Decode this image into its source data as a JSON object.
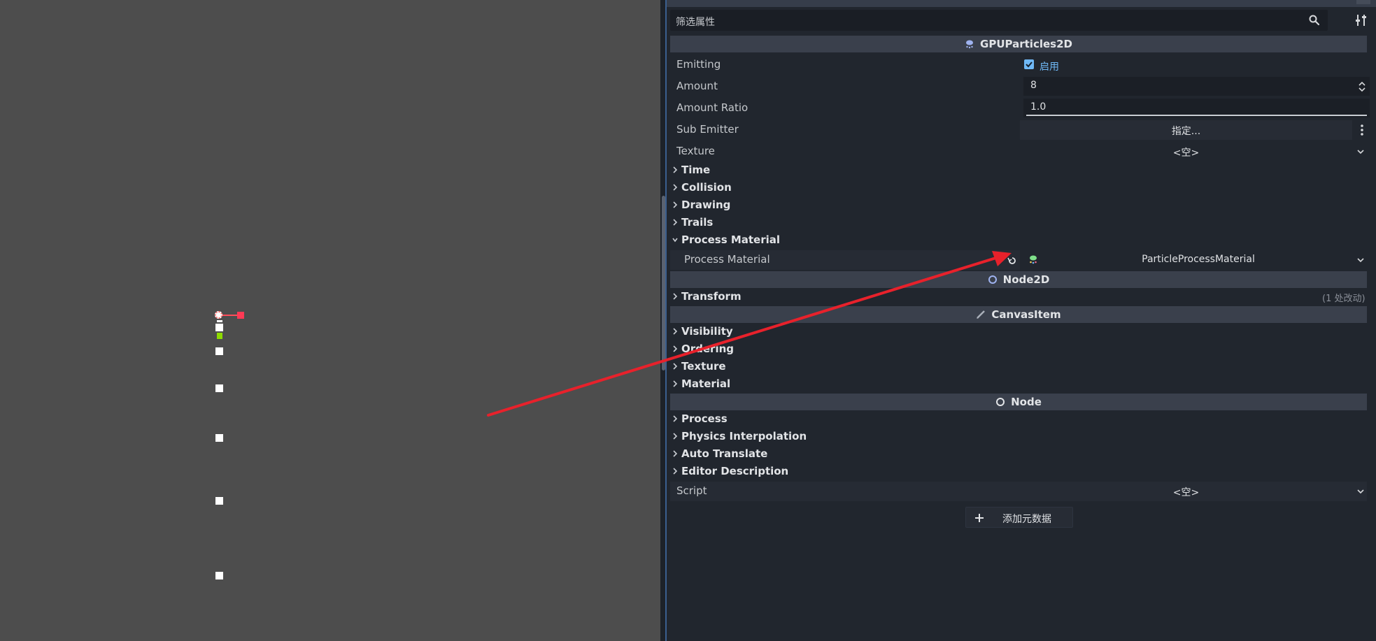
{
  "filter": {
    "placeholder": "筛选属性"
  },
  "sections": {
    "gpu": "GPUParticles2D",
    "node2d": "Node2D",
    "canvas": "CanvasItem",
    "node": "Node"
  },
  "props": {
    "emitting": {
      "label": "Emitting",
      "checked": true,
      "value": "启用"
    },
    "amount": {
      "label": "Amount",
      "value": "8"
    },
    "amount_ratio": {
      "label": "Amount Ratio",
      "value": "1.0"
    },
    "sub_emitter": {
      "label": "Sub Emitter",
      "value": "指定..."
    },
    "texture": {
      "label": "Texture",
      "value": "<空>"
    },
    "process_material": {
      "label": "Process Material",
      "value": "ParticleProcessMaterial"
    },
    "script": {
      "label": "Script",
      "value": "<空>"
    }
  },
  "groups": {
    "time": "Time",
    "collision": "Collision",
    "drawing": "Drawing",
    "trails": "Trails",
    "process_material": "Process Material",
    "transform": "Transform",
    "transform_badge": "(1 处改动)",
    "visibility": "Visibility",
    "ordering": "Ordering",
    "texture": "Texture",
    "material": "Material",
    "process": "Process",
    "physics_interp": "Physics Interpolation",
    "auto_translate": "Auto Translate",
    "editor_desc": "Editor Description"
  },
  "add_metadata": {
    "label": "添加元数据"
  },
  "colors": {
    "annotation_arrow": "#e8212b",
    "checkbox_accent": "#6fb8f5",
    "particles_icon": "#9fb3f0"
  }
}
